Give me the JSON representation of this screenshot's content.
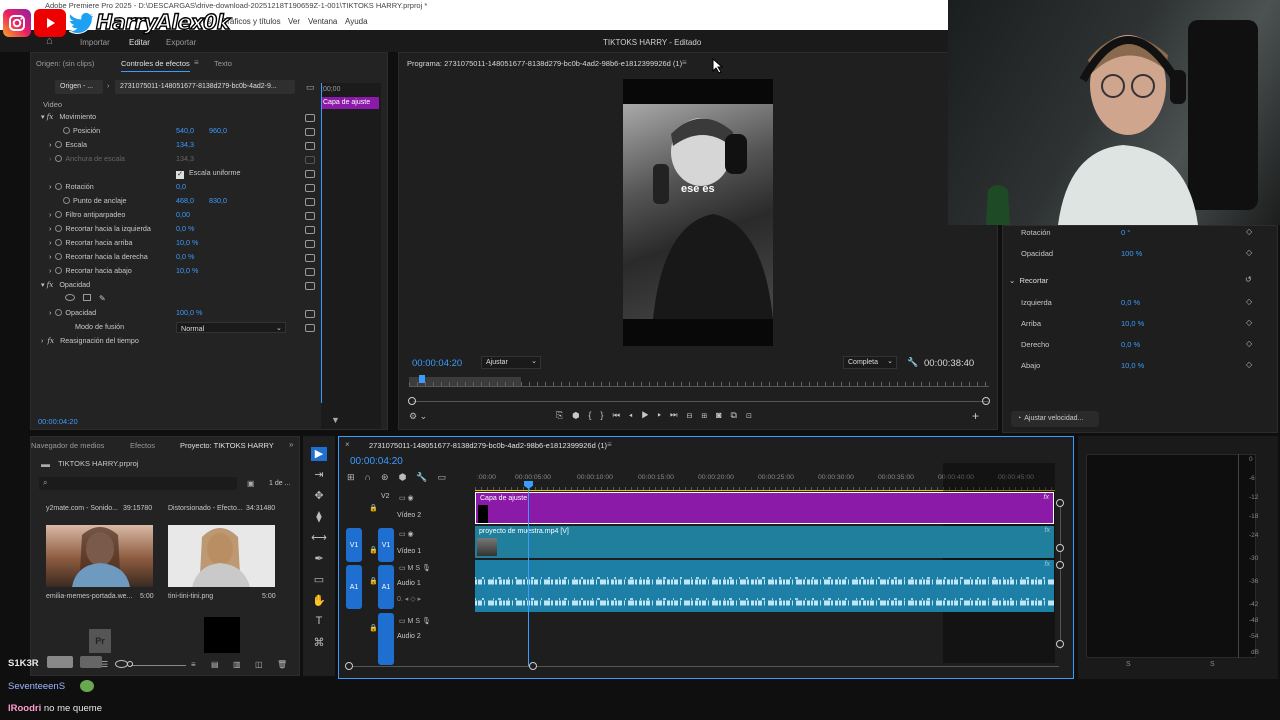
{
  "titlebar": {
    "title": "Adobe Premiere Pro 2025 - D:\\DESCARGAS\\drive-download-20251218T190659Z-1-001\\TIKTOKS HARRY.prproj *",
    "menu": [
      "res",
      "Gráficos y títulos",
      "Ver",
      "Ventana",
      "Ayuda"
    ]
  },
  "social": {
    "handle": "HarryAlex0k"
  },
  "workspace": {
    "tabs": [
      "Importar",
      "Editar",
      "Exportar"
    ],
    "project_title": "TIKTOKS HARRY - Editado"
  },
  "effects": {
    "source_tab": "Origen: (sin clips)",
    "controls_tab": "Controles de efectos",
    "text_tab": "Texto",
    "source_dropdown": "Origen - ...",
    "clip_name": "2731075011-148051677-8138d279-bc0b-4ad2-9...",
    "mini_clip": "Capa de ajuste",
    "mini_time": ";00;00",
    "video_label": "Video",
    "rows": [
      {
        "name": "Movimiento",
        "v1": "",
        "v2": ""
      },
      {
        "name": "Posición",
        "v1": "540,0",
        "v2": "960,0"
      },
      {
        "name": "Escala",
        "v1": "134,3",
        "v2": ""
      },
      {
        "name": "Anchura de escala",
        "v1": "134,3",
        "v2": ""
      },
      {
        "name": "Escala uniforme",
        "v1": "",
        "v2": ""
      },
      {
        "name": "Rotación",
        "v1": "0,0",
        "v2": ""
      },
      {
        "name": "Punto de anclaje",
        "v1": "468,0",
        "v2": "830,0"
      },
      {
        "name": "Filtro antiparpadeo",
        "v1": "0,00",
        "v2": ""
      },
      {
        "name": "Recortar hacia la izquierda",
        "v1": "0,0 %",
        "v2": ""
      },
      {
        "name": "Recortar hacia arriba",
        "v1": "10,0 %",
        "v2": ""
      },
      {
        "name": "Recortar hacia la derecha",
        "v1": "0,0 %",
        "v2": ""
      },
      {
        "name": "Recortar hacia abajo",
        "v1": "10,0 %",
        "v2": ""
      },
      {
        "name": "Opacidad",
        "v1": "",
        "v2": ""
      },
      {
        "name": "Opacidad",
        "v1": "100,0 %",
        "v2": ""
      },
      {
        "name": "Modo de fusión",
        "v1": "Normal",
        "v2": ""
      },
      {
        "name": "Reasignación del tiempo",
        "v1": "",
        "v2": ""
      }
    ],
    "timecode": "00:00:04:20"
  },
  "program": {
    "title": "Programa: 2731075011-148051677-8138d279-bc0b-4ad2-98b6-e1812399926d (1)",
    "caption": "ese es",
    "timecode": "00:00:04:20",
    "fit": "Ajustar",
    "quality": "Completa",
    "duration": "00:00:38:40"
  },
  "right_panel": {
    "rows": [
      {
        "label": "Rotación",
        "value": "0 °"
      },
      {
        "label": "Opacidad",
        "value": "100 %"
      },
      {
        "label": "Recortar",
        "value": ""
      },
      {
        "label": "Izquierda",
        "value": "0,0 %"
      },
      {
        "label": "Arriba",
        "value": "10,0 %"
      },
      {
        "label": "Derecho",
        "value": "0,0 %"
      },
      {
        "label": "Abajo",
        "value": "10,0 %"
      }
    ],
    "speed_button": "Ajustar velocidad..."
  },
  "project": {
    "tabs": [
      "Navegador de medios",
      "Efectos",
      "Proyecto: TIKTOKS HARRY"
    ],
    "file": "TIKTOKS HARRY.prproj",
    "count": "1 de ...",
    "items": [
      {
        "name": "y2mate.com - Sonido...",
        "duration": "39:15780"
      },
      {
        "name": "Distorsionado - Efecto...",
        "duration": "34:31480"
      },
      {
        "name": "emilia-memes-portada.we...",
        "duration": "5:00"
      },
      {
        "name": "tini-tini-tini.png",
        "duration": "5:00"
      }
    ]
  },
  "timeline": {
    "title": "2731075011-148051677-8138d279-bc0b-4ad2-98b6-e1812399926d (1)",
    "timecode": "00:00:04:20",
    "ruler": [
      ":00:00",
      "00:00:05:00",
      "00:00:10:00",
      "00:00:15:00",
      "00:00:20:00",
      "00:00:25:00",
      "00:00:30:00",
      "00:00:35:00",
      "00:00:40:00",
      "00:00:45:00"
    ],
    "tracks": [
      {
        "id": "V2",
        "name": "Vídeo 2",
        "clip": "Capa de ajuste"
      },
      {
        "id": "V1",
        "name": "Vídeo 1",
        "clip": "proyecto de muestra.mp4 [V]"
      },
      {
        "id": "A1",
        "name": "Audio 1",
        "clip": ""
      },
      {
        "id": "A2",
        "name": "Audio 2",
        "clip": ""
      }
    ]
  },
  "meter": {
    "labels": [
      "0",
      "-6",
      "-12",
      "-18",
      "-24",
      "-30",
      "-36",
      "-42",
      "-48",
      "-54",
      "dB"
    ],
    "channels": [
      "S",
      "S"
    ]
  },
  "chat": [
    {
      "user": "S1K3R",
      "text": "",
      "color": "#e0e0e0"
    },
    {
      "user": "SeventeeenS",
      "text": "",
      "color": "#9bb7ff"
    },
    {
      "user": "lRoodri",
      "text": "no me queme",
      "color": "#ff9dcb"
    }
  ],
  "colors": {
    "accent": "#3b9cff",
    "adjust_clip": "#8c1aa8",
    "video_clip": "#1f7f9c",
    "audio_clip": "#1e7fa6"
  }
}
